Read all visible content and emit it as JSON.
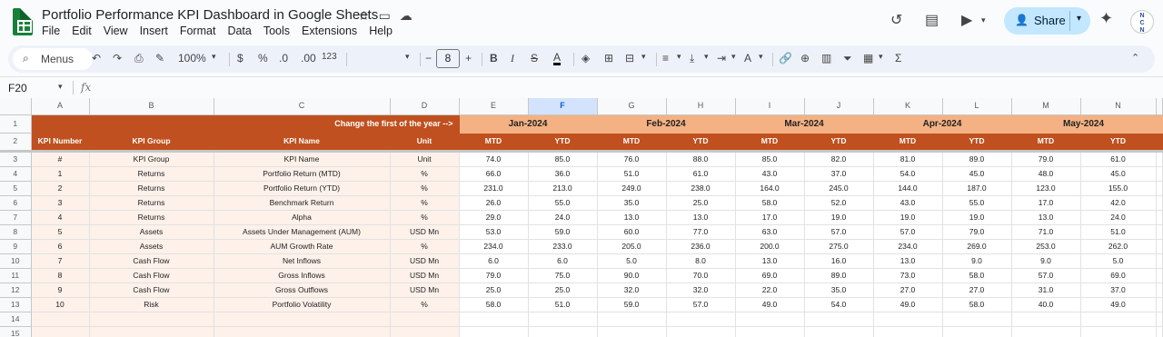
{
  "doc": {
    "title": "Portfolio Performance KPI Dashboard in Google Sheets",
    "title_icons": [
      "star-icon",
      "move-to-folder-icon",
      "cloud-status-icon"
    ]
  },
  "menu": [
    "File",
    "Edit",
    "View",
    "Insert",
    "Format",
    "Data",
    "Tools",
    "Extensions",
    "Help"
  ],
  "header_right": {
    "share_label": "Share",
    "avatar_text": "N"
  },
  "toolbar": {
    "search_label": "Menus",
    "zoom": "100%",
    "currency": "$",
    "percent": "%",
    "decrease_decimal": ".0",
    "increase_decimal": ".00",
    "number_format": "123",
    "font_size": "8"
  },
  "formula_bar": {
    "cell_ref": "F20",
    "fx": "fx",
    "value": ""
  },
  "grid": {
    "columns": [
      "A",
      "B",
      "C",
      "D",
      "E",
      "F",
      "G",
      "H",
      "I",
      "J",
      "K",
      "L",
      "M",
      "N"
    ],
    "selected_column": "F",
    "row_numbers": [
      "1",
      "2",
      "3",
      "4",
      "5",
      "6",
      "7",
      "8",
      "9",
      "10",
      "11",
      "12",
      "13",
      "14",
      "15"
    ],
    "row1_note": "Change the first of the year -->",
    "months": [
      "Jan-2024",
      "Feb-2024",
      "Mar-2024",
      "Apr-2024",
      "May-2024"
    ],
    "row2_headers": [
      "KPI Number",
      "KPI Group",
      "KPI Name",
      "Unit"
    ],
    "mtd": "MTD",
    "ytd": "YTD",
    "rows": [
      {
        "num": "#",
        "group": "KPI Group",
        "name": "KPI Name",
        "unit": "Unit",
        "vals": [
          "74.0",
          "85.0",
          "76.0",
          "88.0",
          "85.0",
          "82.0",
          "81.0",
          "89.0",
          "79.0",
          "61.0"
        ]
      },
      {
        "num": "1",
        "group": "Returns",
        "name": "Portfolio Return (MTD)",
        "unit": "%",
        "vals": [
          "66.0",
          "36.0",
          "51.0",
          "61.0",
          "43.0",
          "37.0",
          "54.0",
          "45.0",
          "48.0",
          "45.0"
        ]
      },
      {
        "num": "2",
        "group": "Returns",
        "name": "Portfolio Return (YTD)",
        "unit": "%",
        "vals": [
          "231.0",
          "213.0",
          "249.0",
          "238.0",
          "164.0",
          "245.0",
          "144.0",
          "187.0",
          "123.0",
          "155.0"
        ]
      },
      {
        "num": "3",
        "group": "Returns",
        "name": "Benchmark Return",
        "unit": "%",
        "vals": [
          "26.0",
          "55.0",
          "35.0",
          "25.0",
          "58.0",
          "52.0",
          "43.0",
          "55.0",
          "17.0",
          "42.0"
        ]
      },
      {
        "num": "4",
        "group": "Returns",
        "name": "Alpha",
        "unit": "%",
        "vals": [
          "29.0",
          "24.0",
          "13.0",
          "13.0",
          "17.0",
          "19.0",
          "19.0",
          "19.0",
          "13.0",
          "24.0"
        ]
      },
      {
        "num": "5",
        "group": "Assets",
        "name": "Assets Under Management (AUM)",
        "unit": "USD Mn",
        "vals": [
          "53.0",
          "59.0",
          "60.0",
          "77.0",
          "63.0",
          "57.0",
          "57.0",
          "79.0",
          "71.0",
          "51.0"
        ]
      },
      {
        "num": "6",
        "group": "Assets",
        "name": "AUM Growth Rate",
        "unit": "%",
        "vals": [
          "234.0",
          "233.0",
          "205.0",
          "236.0",
          "200.0",
          "275.0",
          "234.0",
          "269.0",
          "253.0",
          "262.0"
        ]
      },
      {
        "num": "7",
        "group": "Cash Flow",
        "name": "Net Inflows",
        "unit": "USD Mn",
        "vals": [
          "6.0",
          "6.0",
          "5.0",
          "8.0",
          "13.0",
          "16.0",
          "13.0",
          "9.0",
          "9.0",
          "5.0"
        ]
      },
      {
        "num": "8",
        "group": "Cash Flow",
        "name": "Gross Inflows",
        "unit": "USD Mn",
        "vals": [
          "79.0",
          "75.0",
          "90.0",
          "70.0",
          "69.0",
          "89.0",
          "73.0",
          "58.0",
          "57.0",
          "69.0"
        ]
      },
      {
        "num": "9",
        "group": "Cash Flow",
        "name": "Gross Outflows",
        "unit": "USD Mn",
        "vals": [
          "25.0",
          "25.0",
          "32.0",
          "32.0",
          "22.0",
          "35.0",
          "27.0",
          "27.0",
          "31.0",
          "37.0"
        ]
      },
      {
        "num": "10",
        "group": "Risk",
        "name": "Portfolio Volatility",
        "unit": "%",
        "vals": [
          "58.0",
          "51.0",
          "59.0",
          "57.0",
          "49.0",
          "54.0",
          "49.0",
          "58.0",
          "40.0",
          "49.0"
        ]
      }
    ]
  },
  "colors": {
    "header_dark": "#c0501f",
    "header_light": "#f4b183",
    "left_data_bg": "#fdf1ea",
    "share_bg": "#c2e7ff"
  }
}
